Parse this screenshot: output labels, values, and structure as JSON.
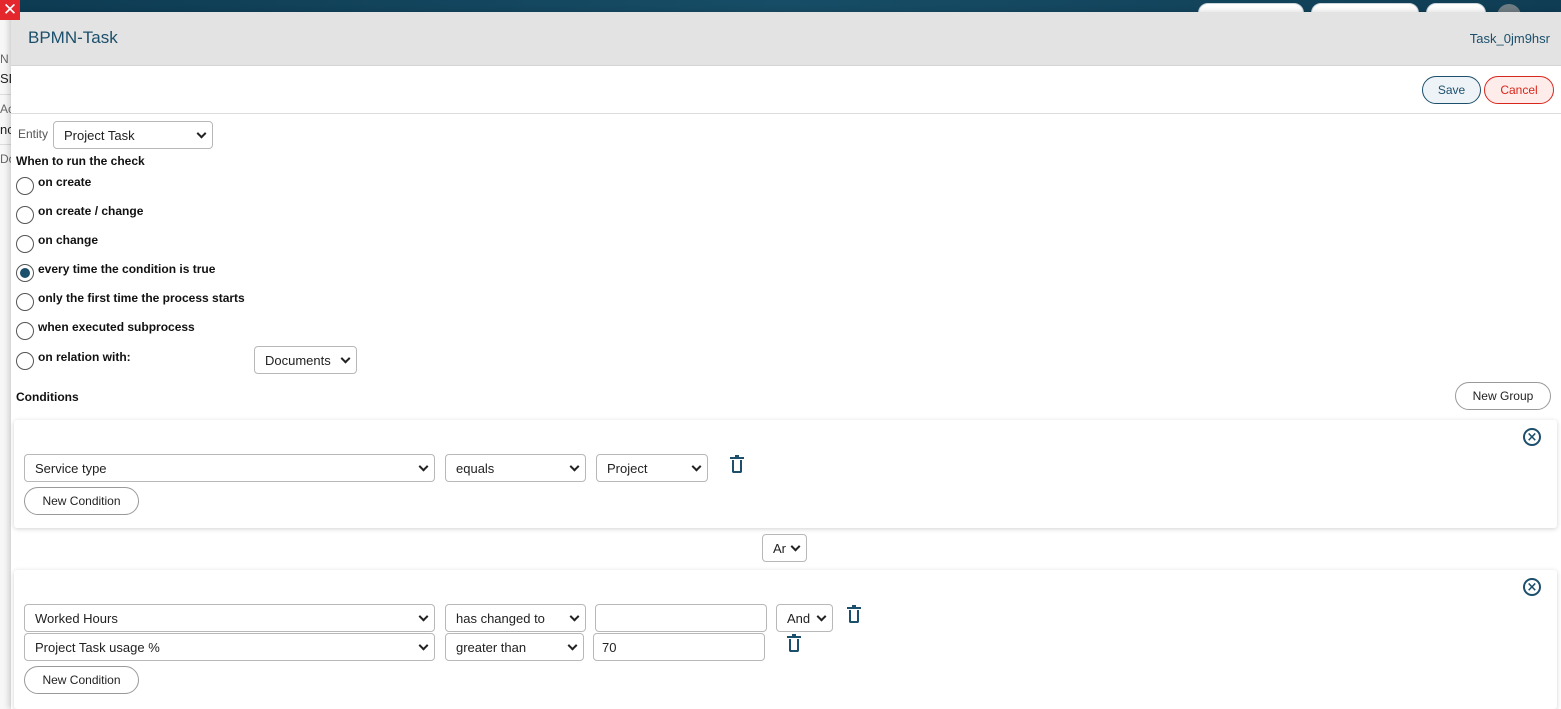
{
  "modal": {
    "title": "BPMN-Task",
    "task_id": "Task_0jm9hsr",
    "save_label": "Save",
    "cancel_label": "Cancel"
  },
  "background": {
    "close_glyph": "✕",
    "fragments": [
      "N",
      "SD",
      "Ac",
      "nc",
      "Do"
    ]
  },
  "entity": {
    "label": "Entity",
    "value": "Project Task"
  },
  "trigger": {
    "heading": "When to run the check",
    "options": [
      {
        "label": "on create",
        "selected": false
      },
      {
        "label": "on create / change",
        "selected": false
      },
      {
        "label": "on change",
        "selected": false
      },
      {
        "label": "every time the condition is true",
        "selected": true
      },
      {
        "label": "only the first time the process starts",
        "selected": false
      },
      {
        "label": "when executed subprocess",
        "selected": false
      },
      {
        "label": "on relation with:",
        "selected": false
      }
    ],
    "relation_value": "Documents"
  },
  "conditions": {
    "heading": "Conditions",
    "new_group_label": "New Group",
    "group_join": "Ar",
    "groups": [
      {
        "rows": [
          {
            "field": "Service type",
            "operator": "equals",
            "value": "Project",
            "join": ""
          }
        ],
        "new_condition_label": "New Condition"
      },
      {
        "rows": [
          {
            "field": "Worked Hours",
            "operator": "has changed to",
            "value": "",
            "join": "And"
          },
          {
            "field": "Project Task usage %",
            "operator": "greater than",
            "value": "70",
            "join": ""
          }
        ],
        "new_condition_label": "New Condition"
      }
    ]
  },
  "icons": {
    "remove_group": "circle-x-icon",
    "delete_row": "trash-icon",
    "dropdown": "chevron-down-icon",
    "close": "close-icon"
  },
  "colors": {
    "accent": "#1c4f6b",
    "danger": "#d9261c",
    "header_bg": "#e3e3e3"
  }
}
